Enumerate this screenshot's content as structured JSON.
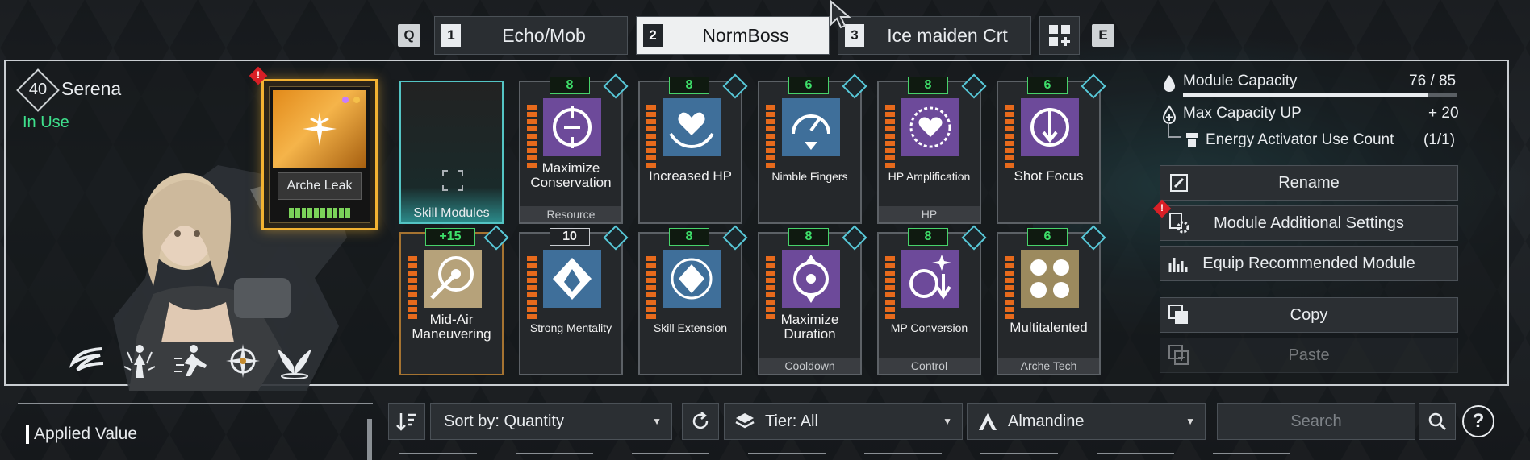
{
  "top_nav": {
    "prev_key": "Q",
    "next_key": "E",
    "presets": [
      {
        "num": "1",
        "name": "Echo/Mob",
        "active": false
      },
      {
        "num": "2",
        "name": "NormBoss",
        "active": true
      },
      {
        "num": "3",
        "name": "Ice maiden Crt",
        "active": false
      }
    ]
  },
  "character": {
    "level": "40",
    "name": "Serena",
    "status": "In Use",
    "skill_icons": [
      "dash-skill-icon",
      "figure-skill-icon",
      "sprint-skill-icon",
      "compass-skill-icon",
      "wings-skill-icon"
    ]
  },
  "arche": {
    "label": "Arche Leak",
    "alert": "!"
  },
  "skill_slot": {
    "label": "Skill Modules"
  },
  "modules": [
    {
      "cap": "8",
      "name": "Maximize Conservation",
      "tag": "Resource",
      "art": "purple"
    },
    {
      "cap": "8",
      "name": "Increased HP",
      "tag": "",
      "art": "blue"
    },
    {
      "cap": "6",
      "name": "Nimble Fingers",
      "tag": "",
      "art": "blue"
    },
    {
      "cap": "8",
      "name": "HP Amplification",
      "tag": "HP",
      "art": "purple"
    },
    {
      "cap": "6",
      "name": "Shot Focus",
      "tag": "",
      "art": "purple"
    },
    {
      "cap": "+15",
      "name": "Mid-Air Maneuvering",
      "tag": "",
      "art": "gold"
    },
    {
      "cap": "10",
      "name": "Strong Mentality",
      "tag": "",
      "art": "blue"
    },
    {
      "cap": "8",
      "name": "Skill Extension",
      "tag": "",
      "art": "blue"
    },
    {
      "cap": "8",
      "name": "Maximize Duration",
      "tag": "Cooldown",
      "art": "purple"
    },
    {
      "cap": "8",
      "name": "MP Conversion",
      "tag": "Control",
      "art": "purple"
    },
    {
      "cap": "6",
      "name": "Multitalented",
      "tag": "Arche Tech",
      "art": "gold"
    }
  ],
  "capacity": {
    "label": "Module Capacity",
    "value": "76 / 85",
    "fraction": 0.894,
    "max_up_label": "Max Capacity UP",
    "max_up_value": "+ 20",
    "activator_label": "Energy Activator Use Count",
    "activator_value": "(1/1)"
  },
  "actions": {
    "rename": "Rename",
    "additional_settings": "Module Additional Settings",
    "equip_recommended": "Equip Recommended Module",
    "copy": "Copy",
    "paste": "Paste"
  },
  "bottom": {
    "applied_value": "Applied Value",
    "sort": "Sort by: Quantity",
    "tier": "Tier: All",
    "socket": "Almandine",
    "search_placeholder": "Search",
    "help": "?"
  }
}
